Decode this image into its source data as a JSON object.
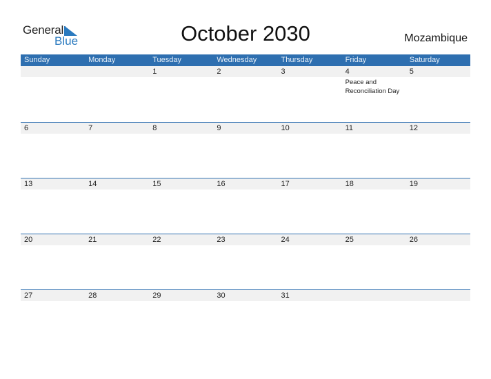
{
  "logo": {
    "line1": "General",
    "line2": "Blue"
  },
  "header": {
    "title": "October 2030",
    "country": "Mozambique"
  },
  "colors": {
    "accent": "#2e6fb0",
    "date_strip": "#f1f1f1"
  },
  "weekdays": [
    "Sunday",
    "Monday",
    "Tuesday",
    "Wednesday",
    "Thursday",
    "Friday",
    "Saturday"
  ],
  "weeks": [
    {
      "days": [
        "",
        "",
        "1",
        "2",
        "3",
        "4",
        "5"
      ],
      "events": [
        "",
        "",
        "",
        "",
        "",
        "Peace and Reconciliation Day",
        ""
      ]
    },
    {
      "days": [
        "6",
        "7",
        "8",
        "9",
        "10",
        "11",
        "12"
      ],
      "events": [
        "",
        "",
        "",
        "",
        "",
        "",
        ""
      ]
    },
    {
      "days": [
        "13",
        "14",
        "15",
        "16",
        "17",
        "18",
        "19"
      ],
      "events": [
        "",
        "",
        "",
        "",
        "",
        "",
        ""
      ]
    },
    {
      "days": [
        "20",
        "21",
        "22",
        "23",
        "24",
        "25",
        "26"
      ],
      "events": [
        "",
        "",
        "",
        "",
        "",
        "",
        ""
      ]
    },
    {
      "days": [
        "27",
        "28",
        "29",
        "30",
        "31",
        "",
        ""
      ],
      "events": [
        "",
        "",
        "",
        "",
        "",
        "",
        ""
      ]
    }
  ]
}
